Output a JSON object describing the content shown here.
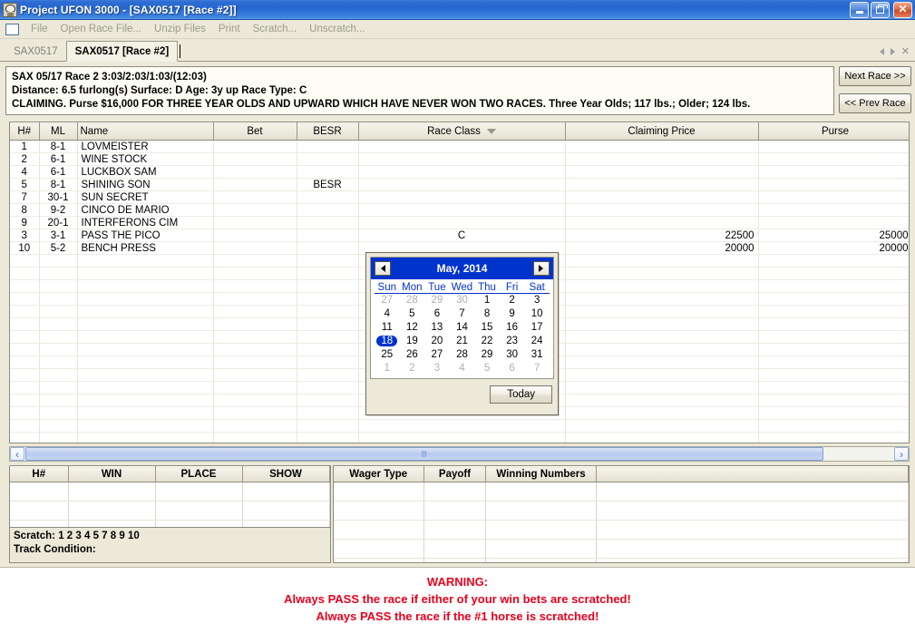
{
  "window": {
    "title": "Project UFON 3000 - [SAX0517 [Race #2]]",
    "icon": "app-mascot-icon",
    "minimize_label": "Minimize",
    "restore_label": "Restore",
    "close_label": "Close"
  },
  "menu": {
    "items": [
      {
        "label": "File"
      },
      {
        "label": "Open Race File..."
      },
      {
        "label": "Unzip Files"
      },
      {
        "label": "Print"
      },
      {
        "label": "Scratch..."
      },
      {
        "label": "Unscratch..."
      }
    ]
  },
  "tabs": {
    "items": [
      {
        "label": "SAX0517",
        "active": false
      },
      {
        "label": "SAX0517 [Race #2]",
        "active": true
      }
    ]
  },
  "race_header": {
    "line1": "SAX 05/17 Race 2 3:03/2:03/1:03/(12:03)",
    "line2": "Distance: 6.5 furlong(s) Surface: D Age: 3y up Race Type: C",
    "line3": "CLAIMING. Purse $16,000 FOR THREE YEAR OLDS AND UPWARD WHICH HAVE NEVER WON TWO RACES. Three Year Olds; 117 lbs.; Older; 124 lbs.",
    "next_race_label": "Next Race >>",
    "prev_race_label": "<< Prev Race"
  },
  "main_grid": {
    "columns": [
      "H#",
      "ML",
      "Name",
      "Bet",
      "BESR",
      "Race Class",
      "Claiming Price",
      "Purse"
    ],
    "sorted_column": "Race Class",
    "sort_direction": "descending",
    "rows": [
      {
        "h": "1",
        "ml": "8-1",
        "name": "LOVMEISTER",
        "bet": "",
        "besr": "",
        "race_class": "",
        "claiming_price": "",
        "purse": ""
      },
      {
        "h": "2",
        "ml": "6-1",
        "name": "WINE STOCK",
        "bet": "",
        "besr": "",
        "race_class": "",
        "claiming_price": "",
        "purse": ""
      },
      {
        "h": "4",
        "ml": "6-1",
        "name": "LUCKBOX SAM",
        "bet": "",
        "besr": "",
        "race_class": "",
        "claiming_price": "",
        "purse": ""
      },
      {
        "h": "5",
        "ml": "8-1",
        "name": "SHINING SON",
        "bet": "",
        "besr": "BESR",
        "race_class": "",
        "claiming_price": "",
        "purse": ""
      },
      {
        "h": "7",
        "ml": "30-1",
        "name": "SUN SECRET",
        "bet": "",
        "besr": "",
        "race_class": "",
        "claiming_price": "",
        "purse": ""
      },
      {
        "h": "8",
        "ml": "9-2",
        "name": "CINCO DE MARIO",
        "bet": "",
        "besr": "",
        "race_class": "",
        "claiming_price": "",
        "purse": ""
      },
      {
        "h": "9",
        "ml": "20-1",
        "name": "INTERFERONS CIM",
        "bet": "",
        "besr": "",
        "race_class": "",
        "claiming_price": "",
        "purse": ""
      },
      {
        "h": "3",
        "ml": "3-1",
        "name": "PASS THE PICO",
        "bet": "",
        "besr": "",
        "race_class": "C",
        "claiming_price": "22500",
        "purse": "25000"
      },
      {
        "h": "10",
        "ml": "5-2",
        "name": "BENCH PRESS",
        "bet": "",
        "besr": "",
        "race_class": "",
        "claiming_price": "20000",
        "purse": "20000"
      }
    ]
  },
  "hscrollbar": {
    "left_arrow": "‹",
    "right_arrow": "›"
  },
  "payoff_grid": {
    "columns": [
      "H#",
      "WIN",
      "PLACE",
      "SHOW",
      ""
    ],
    "rows": [
      [],
      [],
      [],
      []
    ]
  },
  "scratch_panel": {
    "scratch_label": "Scratch: 1 2 3 4 5 7 8 9 10",
    "track_condition_label": "Track Condition:"
  },
  "wager_grid": {
    "columns": [
      "Wager Type",
      "Payoff",
      "Winning Numbers",
      ""
    ],
    "rows": [
      [],
      [],
      [],
      [],
      [],
      [],
      []
    ]
  },
  "calendar": {
    "month_label": "May, 2014",
    "prev_label": "Previous month",
    "next_label": "Next month",
    "weekdays": [
      "Sun",
      "Mon",
      "Tue",
      "Wed",
      "Thu",
      "Fri",
      "Sat"
    ],
    "selected_day": 18,
    "weeks": [
      [
        {
          "d": "27",
          "dim": true
        },
        {
          "d": "28",
          "dim": true
        },
        {
          "d": "29",
          "dim": true
        },
        {
          "d": "30",
          "dim": true
        },
        {
          "d": "1"
        },
        {
          "d": "2"
        },
        {
          "d": "3"
        }
      ],
      [
        {
          "d": "4"
        },
        {
          "d": "5"
        },
        {
          "d": "6"
        },
        {
          "d": "7"
        },
        {
          "d": "8"
        },
        {
          "d": "9"
        },
        {
          "d": "10"
        }
      ],
      [
        {
          "d": "11"
        },
        {
          "d": "12"
        },
        {
          "d": "13"
        },
        {
          "d": "14"
        },
        {
          "d": "15"
        },
        {
          "d": "16"
        },
        {
          "d": "17"
        }
      ],
      [
        {
          "d": "18",
          "sel": true
        },
        {
          "d": "19"
        },
        {
          "d": "20"
        },
        {
          "d": "21"
        },
        {
          "d": "22"
        },
        {
          "d": "23"
        },
        {
          "d": "24"
        }
      ],
      [
        {
          "d": "25"
        },
        {
          "d": "26"
        },
        {
          "d": "27"
        },
        {
          "d": "28"
        },
        {
          "d": "29"
        },
        {
          "d": "30"
        },
        {
          "d": "31"
        }
      ],
      [
        {
          "d": "1",
          "dim": true
        },
        {
          "d": "2",
          "dim": true
        },
        {
          "d": "3",
          "dim": true
        },
        {
          "d": "4",
          "dim": true
        },
        {
          "d": "5",
          "dim": true
        },
        {
          "d": "6",
          "dim": true
        },
        {
          "d": "7",
          "dim": true
        }
      ]
    ],
    "today_label": "Today"
  },
  "warning": {
    "title": "WARNING:",
    "line1": "Always PASS the race if either of your win bets are scratched!",
    "line2": "Always PASS the race if the #1 horse is scratched!",
    "color": "#e8001c"
  }
}
